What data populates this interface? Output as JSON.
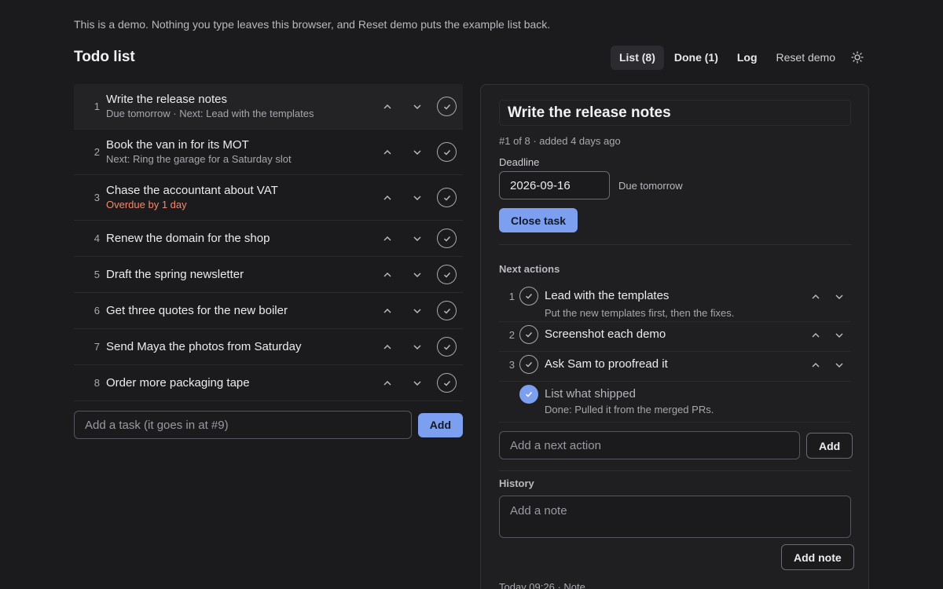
{
  "banner": "This is a demo. Nothing you type leaves this browser, and Reset demo puts the example list back.",
  "header": {
    "title": "Todo list",
    "nav": {
      "list": "List (8)",
      "done": "Done (1)",
      "log": "Log",
      "reset": "Reset demo"
    }
  },
  "tasks": [
    {
      "num": "1",
      "title": "Write the release notes",
      "sub": "Due tomorrow · Next: Lead with the templates",
      "overdue": false,
      "selected": true
    },
    {
      "num": "2",
      "title": "Book the van in for its MOT",
      "sub": "Next: Ring the garage for a Saturday slot",
      "overdue": false
    },
    {
      "num": "3",
      "title": "Chase the accountant about VAT",
      "sub": "Overdue by 1 day",
      "overdue": true
    },
    {
      "num": "4",
      "title": "Renew the domain for the shop",
      "sub": ""
    },
    {
      "num": "5",
      "title": "Draft the spring newsletter",
      "sub": ""
    },
    {
      "num": "6",
      "title": "Get three quotes for the new boiler",
      "sub": ""
    },
    {
      "num": "7",
      "title": "Send Maya the photos from Saturday",
      "sub": ""
    },
    {
      "num": "8",
      "title": "Order more packaging tape",
      "sub": ""
    }
  ],
  "add_task": {
    "placeholder": "Add a task (it goes in at #9)",
    "button": "Add"
  },
  "detail": {
    "title": "Write the release notes",
    "meta": "#1 of 8 · added 4 days ago",
    "deadline_label": "Deadline",
    "deadline_value": "2026-09-16",
    "deadline_relative": "Due tomorrow",
    "close_button": "Close task",
    "next_actions_label": "Next actions",
    "next_actions": [
      {
        "num": "1",
        "title": "Lead with the templates",
        "sub": "Put the new templates first, then the fixes.",
        "done": false
      },
      {
        "num": "2",
        "title": "Screenshot each demo",
        "sub": "",
        "done": false
      },
      {
        "num": "3",
        "title": "Ask Sam to proofread it",
        "sub": "",
        "done": false
      },
      {
        "num": "",
        "title": "List what shipped",
        "sub": "Done: Pulled it from the merged PRs.",
        "done": true
      }
    ],
    "add_next_action": {
      "placeholder": "Add a next action",
      "button": "Add"
    },
    "history_label": "History",
    "note": {
      "placeholder": "Add a note",
      "button": "Add note"
    },
    "history_entry": "Today 09:26 · Note"
  },
  "colors": {
    "accent": "#7c9ff0",
    "overdue": "#f08a6e",
    "background": "#1b1b1d"
  }
}
